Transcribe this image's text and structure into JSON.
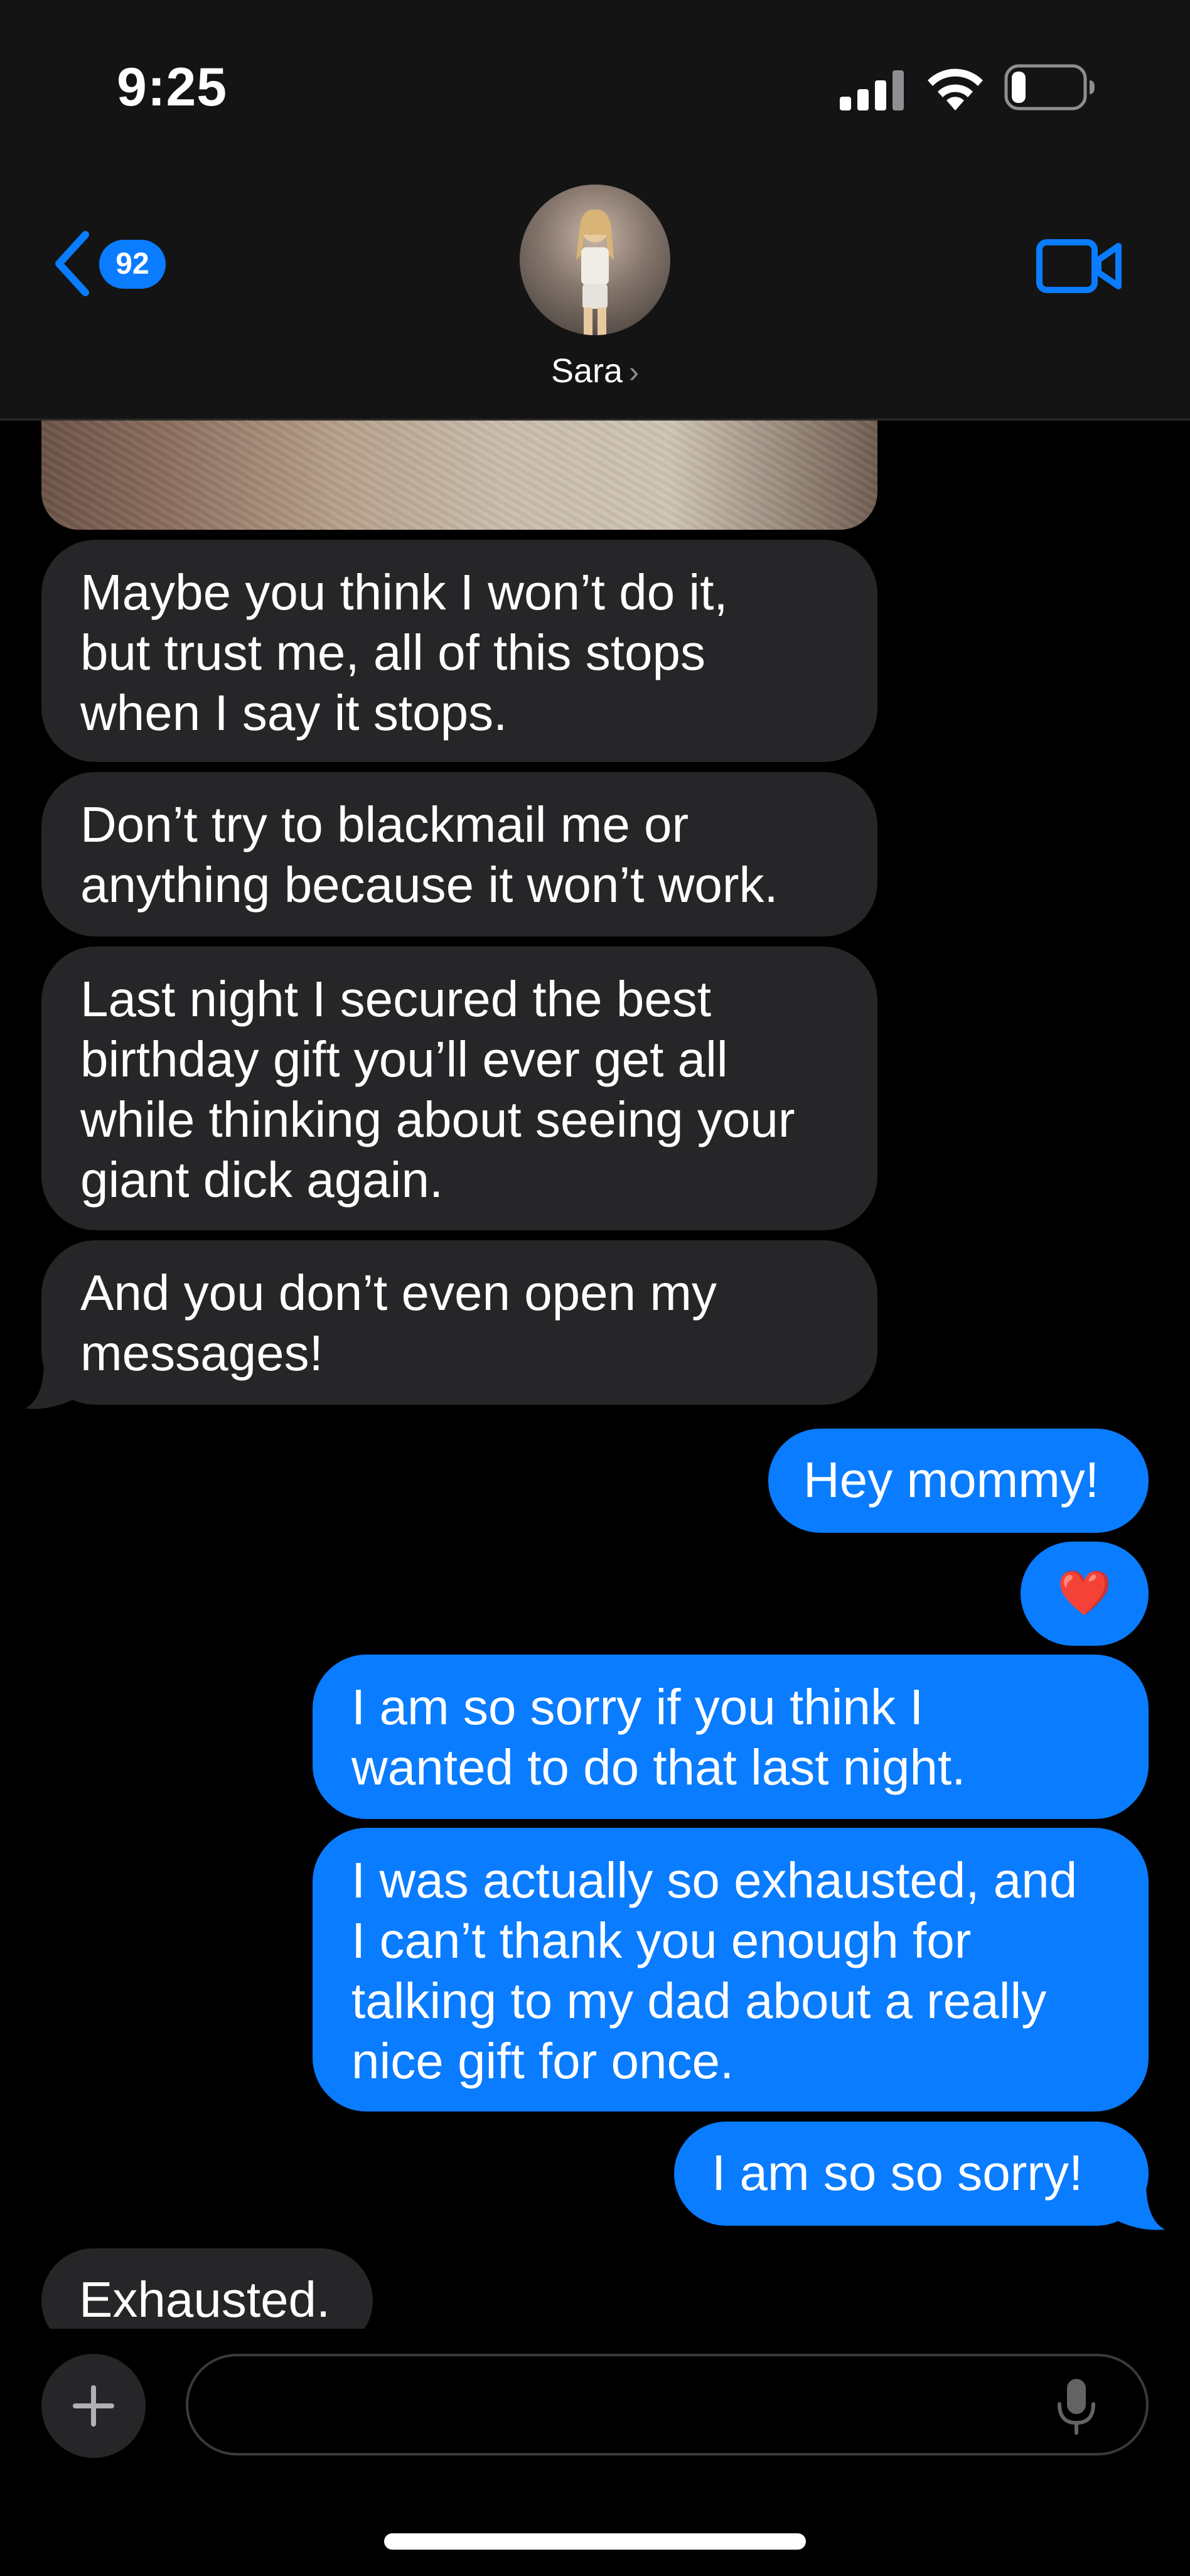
{
  "status_bar": {
    "time": "9:25",
    "signal_icon": "cellular-signal-icon",
    "wifi_icon": "wifi-icon",
    "battery_icon": "battery-icon",
    "battery_level": 0.2
  },
  "header": {
    "back_icon": "chevron-left-icon",
    "unread_count": "92",
    "contact_name": "Sara",
    "contact_chevron": "›",
    "video_icon": "video-camera-icon"
  },
  "colors": {
    "accent": "#0a7cff",
    "incoming_bubble": "#262628",
    "background": "#000000",
    "header_bg": "#141414"
  },
  "messages": [
    {
      "direction": "incoming",
      "type": "photo"
    },
    {
      "direction": "incoming",
      "text": "Maybe you think I won’t do it,\nbut trust me, all of this stops\nwhen I say it stops."
    },
    {
      "direction": "incoming",
      "text": "Don’t try to blackmail me or\nanything because it won’t work."
    },
    {
      "direction": "incoming",
      "text": "Last night I secured the best\nbirthday gift you’ll ever get all\nwhile thinking about seeing your\ngiant dick again."
    },
    {
      "direction": "incoming",
      "text": "And you don’t even open my\nmessages!"
    },
    {
      "direction": "outgoing",
      "text": "Hey mommy!"
    },
    {
      "direction": "outgoing",
      "text": "❤️"
    },
    {
      "direction": "outgoing",
      "text": "I am so sorry if you think I\nwanted to do that last night."
    },
    {
      "direction": "outgoing",
      "text": "I was actually so exhausted, and\nI can’t thank you enough for\ntalking to my dad about a really\nnice gift for once."
    },
    {
      "direction": "outgoing",
      "text": "I am so so sorry!"
    },
    {
      "direction": "incoming",
      "text": "Exhausted."
    }
  ],
  "input_bar": {
    "plus_icon": "plus-icon",
    "placeholder": "",
    "value": "",
    "mic_icon": "microphone-icon"
  }
}
